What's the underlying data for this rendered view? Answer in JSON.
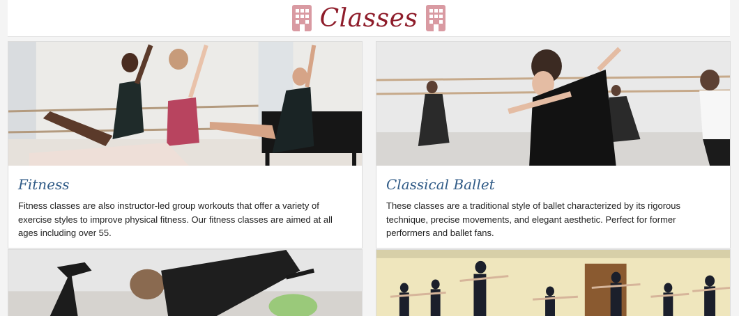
{
  "header": {
    "title": "Classes",
    "icon_left": "building-icon",
    "icon_right": "building-icon"
  },
  "colors": {
    "title": "#8e1c2a",
    "icon": "#d99aa2",
    "card_title": "#2f5a86"
  },
  "cards": [
    {
      "title": "Fitness",
      "text": "Fitness classes are also instructor-led group workouts that offer a variety of exercise styles to improve physical fitness. Our fitness classes are aimed at all ages including over 55.",
      "image": "dancers-at-barre-photo"
    },
    {
      "title": "Classical Ballet",
      "text": "These classes are a traditional style of ballet characterized by its rigorous technique, precise movements, and elegant aesthetic. Perfect for former performers and ballet fans.",
      "image": "contemporary-dance-class-photo"
    }
  ],
  "lower_images": [
    "floor-exercise-photo",
    "ballet-class-studio-photo"
  ]
}
